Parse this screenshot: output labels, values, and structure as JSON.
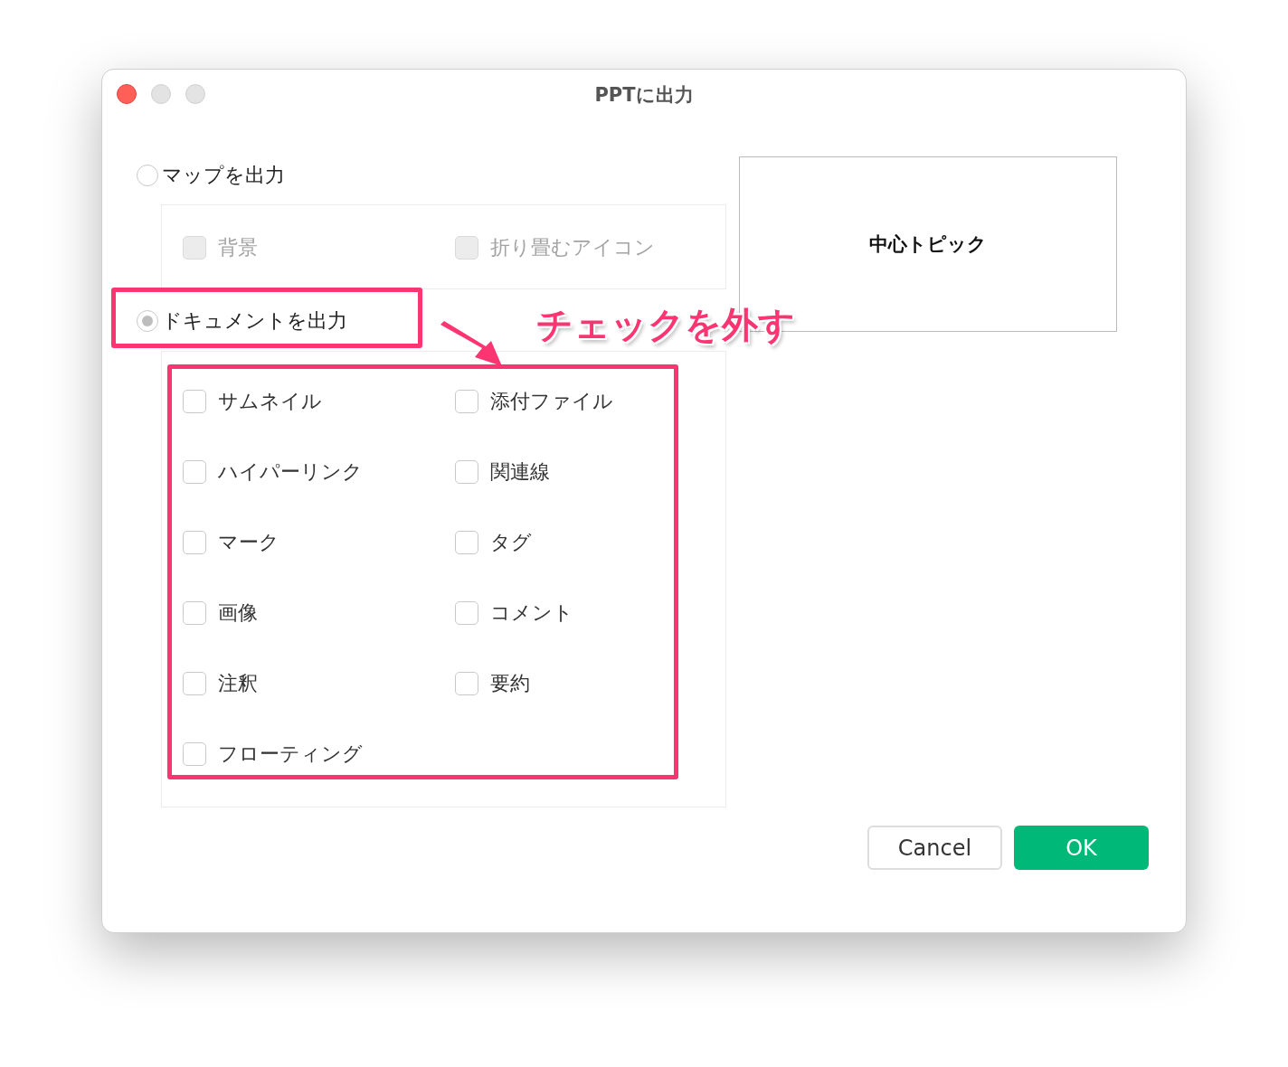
{
  "window": {
    "title": "PPTに出力"
  },
  "options": [
    {
      "label": "マップを出力",
      "selected": false,
      "checkboxes": [
        {
          "label": "背景",
          "checked": false,
          "disabled": true
        },
        {
          "label": "折り畳むアイコン",
          "checked": false,
          "disabled": true
        }
      ]
    },
    {
      "label": "ドキュメントを出力",
      "selected": true,
      "checkboxes": [
        {
          "label": "サムネイル",
          "checked": false,
          "disabled": false
        },
        {
          "label": "添付ファイル",
          "checked": false,
          "disabled": false
        },
        {
          "label": "ハイパーリンク",
          "checked": false,
          "disabled": false
        },
        {
          "label": "関連線",
          "checked": false,
          "disabled": false
        },
        {
          "label": "マーク",
          "checked": false,
          "disabled": false
        },
        {
          "label": "タグ",
          "checked": false,
          "disabled": false
        },
        {
          "label": "画像",
          "checked": false,
          "disabled": false
        },
        {
          "label": "コメント",
          "checked": false,
          "disabled": false
        },
        {
          "label": "注釈",
          "checked": false,
          "disabled": false
        },
        {
          "label": "要約",
          "checked": false,
          "disabled": false
        },
        {
          "label": "フローティング",
          "checked": false,
          "disabled": false
        }
      ]
    }
  ],
  "preview": {
    "topic": "中心トピック"
  },
  "buttons": [
    {
      "label": "Cancel",
      "kind": "secondary"
    },
    {
      "label": "OK",
      "kind": "primary"
    }
  ],
  "annotation": {
    "callout": "チェックを外す"
  }
}
